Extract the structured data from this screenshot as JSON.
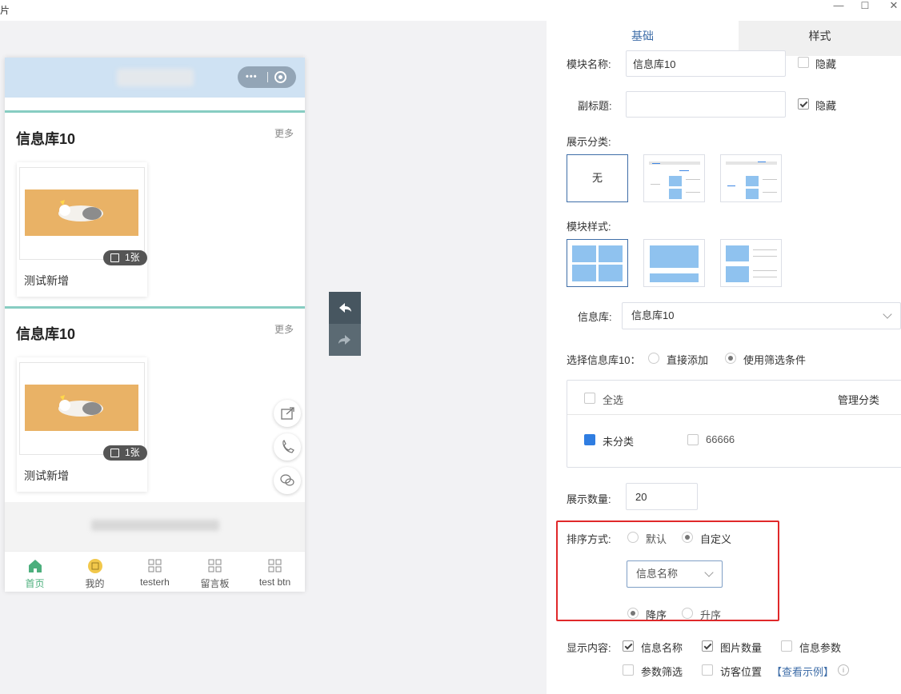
{
  "window": {
    "title": "片",
    "minimize": "—",
    "maximize": "☐",
    "close": "✕"
  },
  "preview": {
    "sections": [
      {
        "title": "信息库10",
        "more": "更多",
        "card": {
          "badge": "1张",
          "name": "测试新增"
        }
      },
      {
        "title": "信息库10",
        "more": "更多",
        "card": {
          "badge": "1张",
          "name": "测试新增"
        }
      }
    ],
    "tabs": [
      {
        "label": "首页",
        "icon": "home-icon"
      },
      {
        "label": "我的",
        "icon": "profile-icon"
      },
      {
        "label": "testerh",
        "icon": "grid-icon"
      },
      {
        "label": "留言板",
        "icon": "grid-icon"
      },
      {
        "label": "test btn",
        "icon": "grid-icon"
      }
    ],
    "colors": {
      "accent": "#4caf7d",
      "header": "#cfe2f3",
      "divider": "#87cdc2"
    }
  },
  "panel": {
    "tabs": {
      "basic": "基础",
      "style": "样式"
    },
    "module_name": {
      "label": "模块名称:",
      "value": "信息库10",
      "hide": "隐藏"
    },
    "subtitle": {
      "label": "副标题:",
      "value": "",
      "hide": "隐藏"
    },
    "show_category": {
      "label": "展示分类:",
      "none": "无"
    },
    "module_style": {
      "label": "模块样式:"
    },
    "library": {
      "label": "信息库:",
      "value": "信息库10"
    },
    "select": {
      "label": "选择信息库10：",
      "direct": "直接添加",
      "filter": "使用筛选条件"
    },
    "category_box": {
      "all": "全选",
      "manage": "管理分类",
      "items": [
        "未分类",
        "66666"
      ]
    },
    "count": {
      "label": "展示数量:",
      "value": "20"
    },
    "sort": {
      "label": "排序方式:",
      "default": "默认",
      "custom": "自定义",
      "field": "信息名称",
      "desc": "降序",
      "asc": "升序"
    },
    "display": {
      "label": "显示内容:",
      "items": [
        "信息名称",
        "图片数量",
        "信息参数",
        "参数筛选",
        "访客位置"
      ],
      "example": "【查看示例】",
      "info": "i"
    }
  }
}
